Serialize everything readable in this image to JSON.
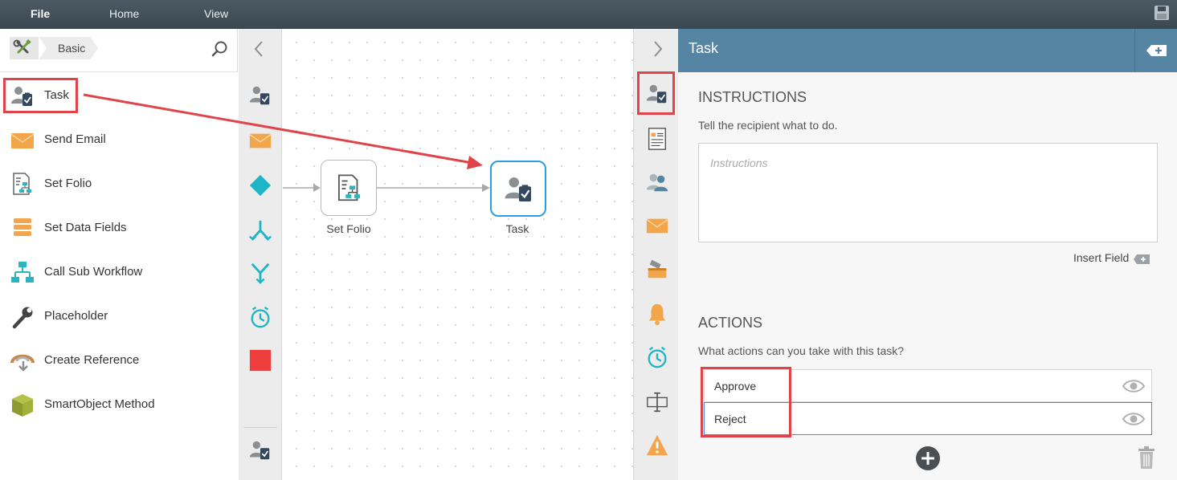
{
  "menubar": {
    "file": "File",
    "home": "Home",
    "view": "View"
  },
  "toolbox": {
    "breadcrumb": "Basic",
    "items": [
      {
        "label": "Task",
        "icon": "task-icon"
      },
      {
        "label": "Send Email",
        "icon": "email-icon"
      },
      {
        "label": "Set Folio",
        "icon": "set-folio-icon"
      },
      {
        "label": "Set Data Fields",
        "icon": "data-fields-icon"
      },
      {
        "label": "Call Sub Workflow",
        "icon": "sub-workflow-icon"
      },
      {
        "label": "Placeholder",
        "icon": "wrench-icon"
      },
      {
        "label": "Create Reference",
        "icon": "reference-icon"
      },
      {
        "label": "SmartObject Method",
        "icon": "smartobject-icon"
      }
    ]
  },
  "canvas": {
    "nodes": [
      {
        "label": "Set Folio"
      },
      {
        "label": "Task"
      }
    ]
  },
  "panel": {
    "title": "Task",
    "instructions": {
      "title": "INSTRUCTIONS",
      "subtitle": "Tell the recipient what to do.",
      "placeholder": "Instructions",
      "insert_field": "Insert Field"
    },
    "actions": {
      "title": "ACTIONS",
      "subtitle": "What actions can you take with this task?",
      "items": [
        {
          "label": "Approve"
        },
        {
          "label": "Reject"
        }
      ]
    }
  },
  "colors": {
    "menubar": "#3f4d56",
    "panel_header": "#5585a3",
    "highlight": "#e0444b",
    "selection": "#2f9be0",
    "teal": "#1fb5c9",
    "orange": "#f2a54b",
    "red_stop": "#ee3d3d"
  }
}
